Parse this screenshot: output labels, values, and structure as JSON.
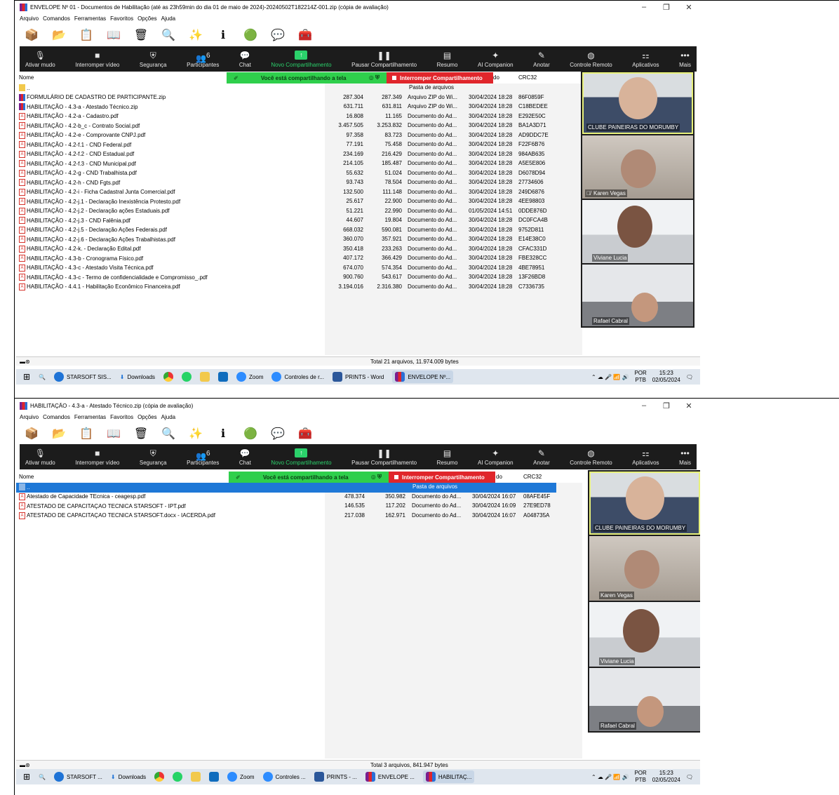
{
  "shots": [
    {
      "window_title": "ENVELOPE Nº 01 - Documentos de Habilitação (até as 23h59min do dia 01 de maio de 2024)-20240502T182214Z-001.zip (cópia de avaliação)",
      "status_total": "Total 21 arquivos, 11.974.009 bytes",
      "files": [
        {
          "name": "..",
          "size": "",
          "packed": "",
          "type": "Pasta de arquivos",
          "modified": "",
          "crc": "",
          "icon": "folder"
        },
        {
          "name": "FORMULÁRIO DE CADASTRO DE PARTICIPANTE.zip",
          "size": "287.304",
          "packed": "287.349",
          "type": "Arquivo ZIP do Wi...",
          "modified": "30/04/2024 18:28",
          "crc": "86F0859F",
          "icon": "zip"
        },
        {
          "name": "HABILITAÇÃO - 4.3-a - Atestado Técnico.zip",
          "size": "631.711",
          "packed": "631.811",
          "type": "Arquivo ZIP do Wi...",
          "modified": "30/04/2024 18:28",
          "crc": "C18BEDEE",
          "icon": "zip"
        },
        {
          "name": "HABILITAÇÃO - 4.2-a - Cadastro.pdf",
          "size": "16.808",
          "packed": "11.165",
          "type": "Documento do Ad...",
          "modified": "30/04/2024 18:28",
          "crc": "E292E50C",
          "icon": "pdf"
        },
        {
          "name": "HABILITAÇÃO - 4.2-b_c - Contrato Social.pdf",
          "size": "3.457.505",
          "packed": "3.253.832",
          "type": "Documento do Ad...",
          "modified": "30/04/2024 18:28",
          "crc": "BA1A3D71",
          "icon": "pdf"
        },
        {
          "name": "HABILITAÇÃO - 4.2-e - Comprovante CNPJ.pdf",
          "size": "97.358",
          "packed": "83.723",
          "type": "Documento do Ad...",
          "modified": "30/04/2024 18:28",
          "crc": "AD9DDC7E",
          "icon": "pdf"
        },
        {
          "name": "HABILITAÇÃO - 4.2-f.1 - CND Federal.pdf",
          "size": "77.191",
          "packed": "75.458",
          "type": "Documento do Ad...",
          "modified": "30/04/2024 18:28",
          "crc": "F22F6B76",
          "icon": "pdf"
        },
        {
          "name": "HABILITAÇÃO - 4.2-f.2 - CND Estadual.pdf",
          "size": "234.169",
          "packed": "216.429",
          "type": "Documento do Ad...",
          "modified": "30/04/2024 18:28",
          "crc": "984AB635",
          "icon": "pdf"
        },
        {
          "name": "HABILITAÇÃO - 4.2-f.3 - CND Municipal.pdf",
          "size": "214.105",
          "packed": "185.487",
          "type": "Documento do Ad...",
          "modified": "30/04/2024 18:28",
          "crc": "A5E5E806",
          "icon": "pdf"
        },
        {
          "name": "HABILITAÇÃO - 4.2-g - CND Trabalhista.pdf",
          "size": "55.632",
          "packed": "51.024",
          "type": "Documento do Ad...",
          "modified": "30/04/2024 18:28",
          "crc": "D6078D94",
          "icon": "pdf"
        },
        {
          "name": "HABILITAÇÃO - 4.2-h - CND Fgts.pdf",
          "size": "93.743",
          "packed": "78.504",
          "type": "Documento do Ad...",
          "modified": "30/04/2024 18:28",
          "crc": "27734606",
          "icon": "pdf"
        },
        {
          "name": "HABILITAÇÃO - 4.2-i - Ficha Cadastral Junta Comercial.pdf",
          "size": "132.500",
          "packed": "111.148",
          "type": "Documento do Ad...",
          "modified": "30/04/2024 18:28",
          "crc": "249D6876",
          "icon": "pdf"
        },
        {
          "name": "HABILITAÇÃO - 4.2-j.1 - Declaração Inexistência Protesto.pdf",
          "size": "25.617",
          "packed": "22.900",
          "type": "Documento do Ad...",
          "modified": "30/04/2024 18:28",
          "crc": "4EE98803",
          "icon": "pdf"
        },
        {
          "name": "HABILITAÇÃO - 4.2-j.2 - Declaração ações Estaduais.pdf",
          "size": "51.221",
          "packed": "22.990",
          "type": "Documento do Ad...",
          "modified": "01/05/2024 14:51",
          "crc": "0DDE876D",
          "icon": "pdf"
        },
        {
          "name": "HABILITAÇÃO - 4.2-j.3 - CND Falênia.pdf",
          "size": "44.607",
          "packed": "19.804",
          "type": "Documento do Ad...",
          "modified": "30/04/2024 18:28",
          "crc": "DC0FCA4B",
          "icon": "pdf"
        },
        {
          "name": "HABILITAÇÃO - 4.2-j.5 - Declaração Ações Federais.pdf",
          "size": "668.032",
          "packed": "590.081",
          "type": "Documento do Ad...",
          "modified": "30/04/2024 18:28",
          "crc": "9752D811",
          "icon": "pdf"
        },
        {
          "name": "HABILITAÇÃO - 4.2-j.6 - Declaração Ações Trabalhistas.pdf",
          "size": "360.070",
          "packed": "357.921",
          "type": "Documento do Ad...",
          "modified": "30/04/2024 18:28",
          "crc": "E14E38C0",
          "icon": "pdf"
        },
        {
          "name": "HABILITAÇÃO - 4.2-k. - Declaração Edital.pdf",
          "size": "350.418",
          "packed": "233.263",
          "type": "Documento do Ad...",
          "modified": "30/04/2024 18:28",
          "crc": "CFAC331D",
          "icon": "pdf"
        },
        {
          "name": "HABILITAÇÃO - 4.3-b - Cronograma Físico.pdf",
          "size": "407.172",
          "packed": "366.429",
          "type": "Documento do Ad...",
          "modified": "30/04/2024 18:28",
          "crc": "FBE328CC",
          "icon": "pdf"
        },
        {
          "name": "HABILITAÇÃO - 4.3-c - Atestado Visita Técnica.pdf",
          "size": "674.070",
          "packed": "574.354",
          "type": "Documento do Ad...",
          "modified": "30/04/2024 18:28",
          "crc": "4BE78951",
          "icon": "pdf"
        },
        {
          "name": "HABILITAÇÃO - 4.3-c - Termo de confidencialidade e Compromisso_.pdf",
          "size": "900.760",
          "packed": "543.617",
          "type": "Documento do Ad...",
          "modified": "30/04/2024 18:28",
          "crc": "13F26BD8",
          "icon": "pdf"
        },
        {
          "name": "HABILITAÇÃO - 4.4.1 - Habilitação Econômico Financeira.pdf",
          "size": "3.194.016",
          "packed": "2.316.380",
          "type": "Documento do Ad...",
          "modified": "30/04/2024 18:28",
          "crc": "C7336735",
          "icon": "pdf"
        }
      ],
      "taskbar": [
        "STARSOFT SIS...",
        "Downloads",
        "Zoom",
        "Controles de r...",
        "PRINTS - Word",
        "ENVELOPE Nº..."
      ]
    },
    {
      "window_title": "HABILITAÇÃO - 4.3-a - Atestado Técnico.zip (cópia de avaliação)",
      "status_total": "Total 3 arquivos, 841.947 bytes",
      "files": [
        {
          "name": "..",
          "size": "",
          "packed": "",
          "type": "Pasta de arquivos",
          "modified": "",
          "crc": "",
          "icon": "folder"
        },
        {
          "name": "Atestado de Capacidade TEcnica - ceagesp.pdf",
          "size": "478.374",
          "packed": "350.982",
          "type": "Documento do Ad...",
          "modified": "30/04/2024 16:07",
          "crc": "08AFE45F",
          "icon": "pdf"
        },
        {
          "name": "ATESTADO DE CAPACITAÇAO TECNICA STARSOFT - IPT.pdf",
          "size": "146.535",
          "packed": "117.202",
          "type": "Documento do Ad...",
          "modified": "30/04/2024 16:09",
          "crc": "27E9ED78",
          "icon": "pdf"
        },
        {
          "name": "ATESTADO DE CAPACITAÇAO TECNICA STARSOFT.docx - IACERDA.pdf",
          "size": "217.038",
          "packed": "162.971",
          "type": "Documento do Ad...",
          "modified": "30/04/2024 16:07",
          "crc": "A048735A",
          "icon": "pdf"
        }
      ],
      "taskbar": [
        "STARSOFT ...",
        "Downloads",
        "Zoom",
        "Controles ...",
        "PRINTS - ...",
        "ENVELOPE ...",
        "HABILITAÇ..."
      ]
    }
  ],
  "menu": [
    "Arquivo",
    "Comandos",
    "Ferramentas",
    "Favoritos",
    "Opções",
    "Ajuda"
  ],
  "columns": {
    "name": "Nome",
    "partial_mod": "do",
    "crc": "CRC32"
  },
  "zoom": {
    "mute": "Ativar mudo",
    "video": "Interromper vídeo",
    "security": "Segurança",
    "participants": "Participantes",
    "participants_count": "6",
    "chat": "Chat",
    "new_share": "Novo Compartilhamento",
    "pause_share": "Pausar Compartilhamento",
    "summary": "Resumo",
    "companion": "AI Companion",
    "annotate": "Anotar",
    "remote": "Controle Remoto",
    "apps": "Aplicativos",
    "more": "Mais",
    "sharing_label": "Você está compartilhando a tela",
    "stop_share": "Interromper Compartilhamento"
  },
  "participants": [
    "CLUBE PAINEIRAS DO MORUMBY",
    "Karen Vegas",
    "Viviane Lucia",
    "Rafael Cabral"
  ],
  "tray": {
    "lang_top": "POR",
    "lang_bottom": "PTB",
    "time": "15:23",
    "date": "02/05/2024"
  }
}
